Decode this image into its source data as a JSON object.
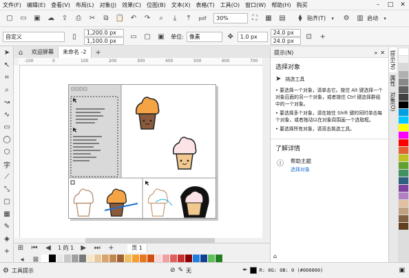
{
  "menubar": {
    "items": [
      "文件(F)",
      "编辑(E)",
      "查看(V)",
      "布局(L)",
      "对象(J)",
      "效果(C)",
      "位图(B)",
      "文本(X)",
      "表格(T)",
      "工具(O)",
      "窗口(W)",
      "帮助(H)",
      "购买"
    ]
  },
  "toolbar": {
    "zoom": "30%",
    "snap_label": "贴齐(T)",
    "launch_label": "启动"
  },
  "propbar": {
    "preset": "自定义",
    "width": "1,200.0 px",
    "height": "1,100.0 px",
    "unit_label": "单位:",
    "unit_value": "像素",
    "nudge": "1.0 px",
    "dup_x": "24.0 px",
    "dup_y": "24.0 px"
  },
  "tabs": [
    {
      "label": "欢迎屏幕",
      "active": false
    },
    {
      "label": "未命名 -2",
      "active": true
    }
  ],
  "ruler_marks": [
    "-100",
    "0",
    "100",
    "200",
    "300",
    "400",
    "500",
    "600",
    "700"
  ],
  "pagenav": {
    "page_of": "1 的 1",
    "page_label": "页 1"
  },
  "docker": {
    "title": "提示(N)",
    "section": "选择对象",
    "tool_name": "挑选工具",
    "bullets": [
      "要选择一个对象，请单击它。按住 Alt 键选择一个对象后面的另一个对象，或者按住 Ctrl 键选择群组中的一个对象。",
      "要选择多个对象，请在按住 Shift 键的同时单击每个对象，或者拖动以在对象周围画一个选取框。",
      "要选择所有对象，请双击挑选工具。"
    ],
    "learn_more": "了解详情",
    "help_topic": "帮助主题",
    "help_link": "选择对象"
  },
  "side_tabs": [
    "提示(N)",
    "属性",
    "对象(O)"
  ],
  "status": {
    "tool_hint": "工具提示",
    "fill_label": "无",
    "color_readout": "R: 0G: 0B: 0 (#000000)"
  },
  "colors": {
    "accent_blue": "#1e6fd0",
    "palette_bottom": [
      "#ffffff",
      "#000000",
      "#e8e8e8",
      "#c8c8c8",
      "#a0a0a0",
      "#787878",
      "#f5e6c8",
      "#e8c89c",
      "#d9a36b",
      "#c08850",
      "#a06030",
      "#f0c060",
      "#f5a030",
      "#e87820",
      "#d05010",
      "#f8d8d8",
      "#f0a0a0",
      "#e06060",
      "#c83030",
      "#8b0000",
      "#2080e0",
      "#104090",
      "#60c060",
      "#208020"
    ],
    "palette_right": [
      "#ffffff",
      "#f0f0f0",
      "#d8d8d8",
      "#b0b0b0",
      "#888888",
      "#606060",
      "#404040",
      "#000000",
      "#00a0e0",
      "#00c8ff",
      "#ffff00",
      "#ff00ff",
      "#ff0000",
      "#e06030",
      "#c0c020",
      "#60a030",
      "#409060",
      "#306080",
      "#8040a0",
      "#b080c0",
      "#e0c0a0",
      "#c0a080",
      "#806040",
      "#604020"
    ]
  }
}
